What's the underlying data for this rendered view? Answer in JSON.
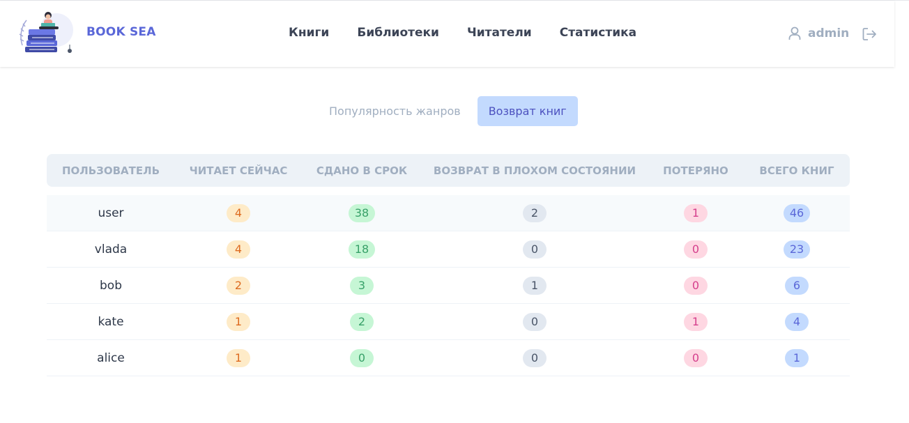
{
  "app": {
    "brand": "BOOK SEA"
  },
  "nav": {
    "items": [
      "Книги",
      "Библиотеки",
      "Читатели",
      "Статистика"
    ]
  },
  "user": {
    "name": "admin"
  },
  "tabs": {
    "genres": "Популярность жанров",
    "returns": "Возврат книг",
    "active": "returns"
  },
  "table": {
    "headers": [
      "ПОЛЬЗОВАТЕЛЬ",
      "ЧИТАЕТ СЕЙЧАС",
      "СДАНО В СРОК",
      "ВОЗВРАТ В ПЛОХОМ СОСТОЯНИИ",
      "ПОТЕРЯНО",
      "ВСЕГО КНИГ"
    ],
    "rows": [
      {
        "user": "user",
        "reading": "4",
        "on_time": "38",
        "bad": "2",
        "lost": "1",
        "total": "46"
      },
      {
        "user": "vlada",
        "reading": "4",
        "on_time": "18",
        "bad": "0",
        "lost": "0",
        "total": "23"
      },
      {
        "user": "bob",
        "reading": "2",
        "on_time": "3",
        "bad": "1",
        "lost": "0",
        "total": "6"
      },
      {
        "user": "kate",
        "reading": "1",
        "on_time": "2",
        "bad": "0",
        "lost": "1",
        "total": "4"
      },
      {
        "user": "alice",
        "reading": "1",
        "on_time": "0",
        "bad": "0",
        "lost": "0",
        "total": "1"
      }
    ]
  },
  "colors": {
    "brand": "#5a67d8",
    "reading": "#feebc8",
    "on_time": "#c6f6d5",
    "bad": "#e2e8f0",
    "lost": "#fed7e2",
    "total": "#c3dafe"
  },
  "icons": {
    "user": "user-icon",
    "logout": "logout-icon",
    "logo": "book-reader-logo"
  }
}
